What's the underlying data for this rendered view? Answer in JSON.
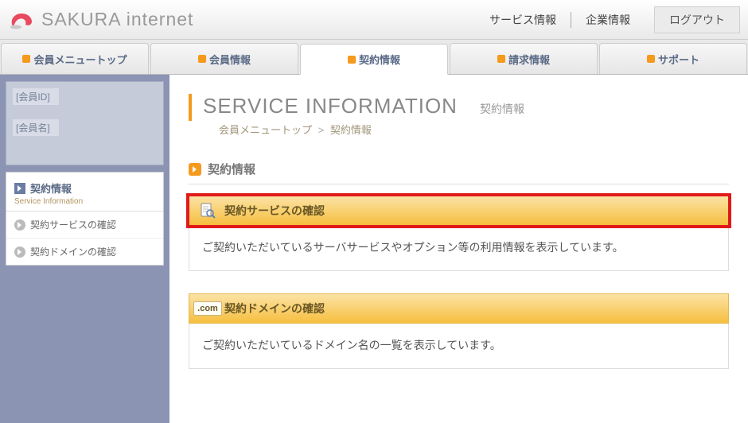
{
  "header": {
    "brand_text": "SAKURA internet",
    "links": [
      "サービス情報",
      "企業情報"
    ],
    "logout_label": "ログアウト"
  },
  "tabs": [
    {
      "label": "会員メニュートップ"
    },
    {
      "label": "会員情報"
    },
    {
      "label": "契約情報"
    },
    {
      "label": "請求情報"
    },
    {
      "label": "サポート"
    }
  ],
  "active_tab_index": 2,
  "sidebar": {
    "account": {
      "id_label": "[会員ID]",
      "name_label": "[会員名]"
    },
    "nav_header": {
      "title": "契約情報",
      "subtitle": "Service Information"
    },
    "items": [
      {
        "label": "契約サービスの確認"
      },
      {
        "label": "契約ドメインの確認"
      }
    ]
  },
  "page": {
    "heading_en": "SERVICE INFORMATION",
    "heading_jp": "契約情報",
    "breadcrumb": {
      "root": "会員メニュートップ",
      "sep": ">",
      "current": "契約情報"
    },
    "section_title": "契約情報",
    "cards": [
      {
        "title": "契約サービスの確認",
        "body": "ご契約いただいているサーバサービスやオプション等の利用情報を表示しています。",
        "highlight": true,
        "icon": "document"
      },
      {
        "title": "契約ドメインの確認",
        "body": "ご契約いただいているドメイン名の一覧を表示しています。",
        "highlight": false,
        "icon": "dotcom"
      }
    ]
  }
}
